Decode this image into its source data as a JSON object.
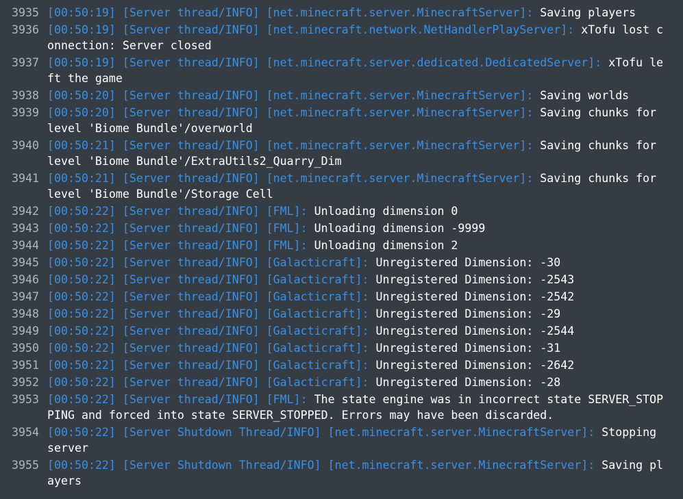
{
  "console": {
    "lines": [
      {
        "num": "3935",
        "prefix": "[00:50:19] [Server thread/INFO] [net.minecraft.server.MinecraftServer]:",
        "message": " Saving players"
      },
      {
        "num": "3936",
        "prefix": "[00:50:19] [Server thread/INFO] [net.minecraft.network.NetHandlerPlayServer]:",
        "message": " xTofu lost connection: Server closed"
      },
      {
        "num": "3937",
        "prefix": "[00:50:19] [Server thread/INFO] [net.minecraft.server.dedicated.DedicatedServer]:",
        "message": " xTofu left the game"
      },
      {
        "num": "3938",
        "prefix": "[00:50:20] [Server thread/INFO] [net.minecraft.server.MinecraftServer]:",
        "message": " Saving worlds"
      },
      {
        "num": "3939",
        "prefix": "[00:50:20] [Server thread/INFO] [net.minecraft.server.MinecraftServer]:",
        "message": " Saving chunks for level 'Biome Bundle'/overworld"
      },
      {
        "num": "3940",
        "prefix": "[00:50:21] [Server thread/INFO] [net.minecraft.server.MinecraftServer]:",
        "message": " Saving chunks for level 'Biome Bundle'/ExtraUtils2_Quarry_Dim"
      },
      {
        "num": "3941",
        "prefix": "[00:50:21] [Server thread/INFO] [net.minecraft.server.MinecraftServer]:",
        "message": " Saving chunks for level 'Biome Bundle'/Storage Cell"
      },
      {
        "num": "3942",
        "prefix": "[00:50:22] [Server thread/INFO] [FML]:",
        "message": " Unloading dimension 0"
      },
      {
        "num": "3943",
        "prefix": "[00:50:22] [Server thread/INFO] [FML]:",
        "message": " Unloading dimension -9999"
      },
      {
        "num": "3944",
        "prefix": "[00:50:22] [Server thread/INFO] [FML]:",
        "message": " Unloading dimension 2"
      },
      {
        "num": "3945",
        "prefix": "[00:50:22] [Server thread/INFO] [Galacticraft]:",
        "message": " Unregistered Dimension: -30"
      },
      {
        "num": "3946",
        "prefix": "[00:50:22] [Server thread/INFO] [Galacticraft]:",
        "message": " Unregistered Dimension: -2543"
      },
      {
        "num": "3947",
        "prefix": "[00:50:22] [Server thread/INFO] [Galacticraft]:",
        "message": " Unregistered Dimension: -2542"
      },
      {
        "num": "3948",
        "prefix": "[00:50:22] [Server thread/INFO] [Galacticraft]:",
        "message": " Unregistered Dimension: -29"
      },
      {
        "num": "3949",
        "prefix": "[00:50:22] [Server thread/INFO] [Galacticraft]:",
        "message": " Unregistered Dimension: -2544"
      },
      {
        "num": "3950",
        "prefix": "[00:50:22] [Server thread/INFO] [Galacticraft]:",
        "message": " Unregistered Dimension: -31"
      },
      {
        "num": "3951",
        "prefix": "[00:50:22] [Server thread/INFO] [Galacticraft]:",
        "message": " Unregistered Dimension: -2642"
      },
      {
        "num": "3952",
        "prefix": "[00:50:22] [Server thread/INFO] [Galacticraft]:",
        "message": " Unregistered Dimension: -28"
      },
      {
        "num": "3953",
        "prefix": "[00:50:22] [Server thread/INFO] [FML]:",
        "message": " The state engine was in incorrect state SERVER_STOPPING and forced into state SERVER_STOPPED. Errors may have been discarded."
      },
      {
        "num": "3954",
        "prefix": "[00:50:22] [Server Shutdown Thread/INFO] [net.minecraft.server.MinecraftServer]:",
        "message": " Stopping server"
      },
      {
        "num": "3955",
        "prefix": "[00:50:22] [Server Shutdown Thread/INFO] [net.minecraft.server.MinecraftServer]:",
        "message": " Saving players"
      }
    ]
  },
  "colors": {
    "background": "#363c44",
    "line_number": "#aeb6c0",
    "prefix": "#3d8fe0",
    "message": "#ffffff"
  }
}
